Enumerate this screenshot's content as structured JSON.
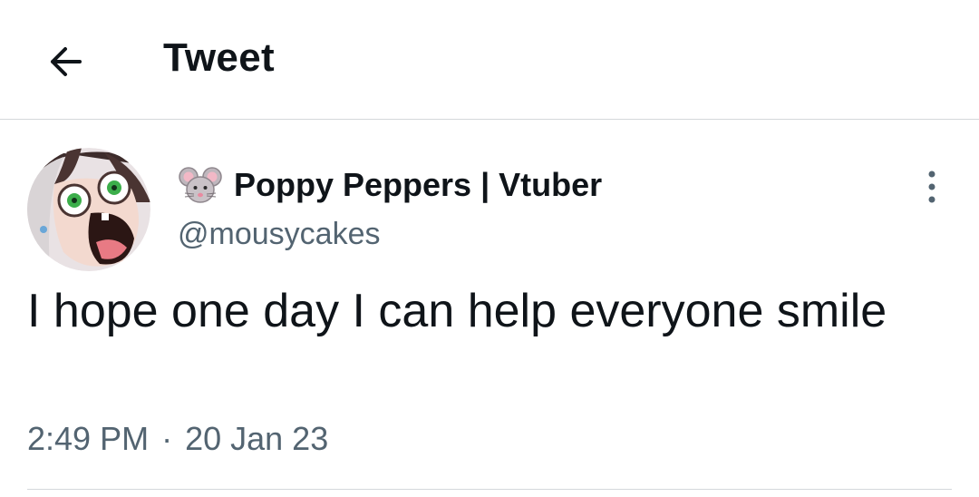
{
  "header": {
    "back_icon": "arrow-left-icon",
    "title": "Tweet"
  },
  "tweet": {
    "author": {
      "emoji_icon": "mouse-face-icon",
      "display_name": "Poppy Peppers | Vtuber",
      "handle": "@mousycakes"
    },
    "more_icon": "vertical-ellipsis-icon",
    "text": "I hope one day I can help everyone smile",
    "time": "2:49 PM",
    "separator": "·",
    "date": "20 Jan 23"
  },
  "colors": {
    "primary_text": "#0f1419",
    "secondary_text": "#536471",
    "divider": "#d4d8db"
  }
}
